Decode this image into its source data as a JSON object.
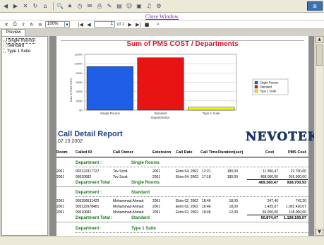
{
  "viewer": {
    "close_link": "Close Window",
    "zoom": "100%",
    "page_current": "1",
    "page_total_label": "of 1",
    "tab_preview": "Preview"
  },
  "tree": [
    "Single Rooms",
    "Standard",
    "Type 1 Suite"
  ],
  "chart_data": {
    "type": "bar",
    "title": "Sum of PMS COST / Departments",
    "xlabel": "Departments",
    "ylabel": "Sum of PMS COST",
    "categories": [
      "Single Rooms",
      "Standard",
      "Type 1 Suite"
    ],
    "values": [
      938000,
      1128000,
      63000
    ],
    "colors": [
      "#1f5fe8",
      "#e81414",
      "#f5f500"
    ],
    "y_ticks": [
      "1200K",
      "1000K",
      "800K",
      "600K",
      "400K",
      "200K",
      "0K"
    ],
    "ylim": [
      0,
      1200000
    ],
    "legend": [
      "Single Rooms",
      "Standard",
      "Type 1 Suite"
    ],
    "legend_position": "right",
    "grid": true
  },
  "detail": {
    "title": "Call Detail Report",
    "date": "07.10.2002",
    "logo": "NEVOTEK",
    "columns": [
      "Room",
      "Called ID",
      "Call Owner",
      "Extension",
      "Call Date",
      "Call Time",
      "Duration(sec)",
      "Cost",
      "PMS Cost"
    ],
    "dept_label": "Department :",
    "total_label": "Department Total :",
    "groups": [
      {
        "name": "Single Rooms",
        "rows": [
          {
            "room": "2001",
            "called": "902122317727",
            "owner": "Tev Scott",
            "ext": "2001",
            "date": "Ekim 04, 2002",
            "time": "12:21",
            "dur": "180,00",
            "cost": "11.360,47",
            "pms": "22.700,00"
          },
          {
            "room": "2001",
            "called": "90610682",
            "owner": "Tev Scott",
            "ext": "2001",
            "date": "Ekim 04, 2002",
            "time": "17:18",
            "dur": "180,00",
            "cost": "458.000,00",
            "pms": "916.000,00"
          }
        ],
        "total_cost": "469.360,47",
        "total_pms": "938.700,93"
      },
      {
        "name": "Standard",
        "rows": [
          {
            "room": "2001",
            "called": "905399531422",
            "owner": "Mohammad Ahmad",
            "ext": "2001",
            "date": "Ekim 02, 2002",
            "time": "18:46",
            "dur": "18,00",
            "cost": "247,40",
            "pms": "742,20"
          },
          {
            "room": "2001",
            "called": "905122978481",
            "owner": "Mohammad Ahmad",
            "ext": "2001",
            "date": "Ekim 02, 2002",
            "time": "18:46",
            "dur": "18,00",
            "cost": "1.425,07",
            "pms": "1.001.426,07"
          },
          {
            "room": "2001",
            "called": "90610682",
            "owner": "Mohammad Ahmad",
            "ext": "2001",
            "date": "Ekim 02, 2002",
            "time": "18:48",
            "dur": "12,00",
            "cost": "60.000,00",
            "pms": "118.000,00"
          }
        ],
        "total_cost": "60.874,47",
        "total_pms": "1.128.165,07"
      },
      {
        "name": "Type 1 Suite",
        "rows": []
      }
    ]
  }
}
